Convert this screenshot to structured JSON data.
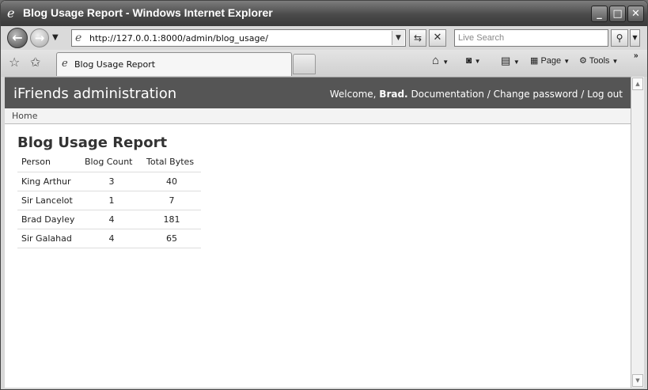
{
  "window": {
    "title": "Blog Usage Report - Windows Internet Explorer",
    "controls": {
      "minimize": "_",
      "maximize": "□",
      "close": "✕"
    }
  },
  "browser": {
    "address": "http://127.0.0.1:8000/admin/blog_usage/",
    "search_placeholder": "Live Search",
    "tab_title": "Blog Usage Report",
    "toolbar": {
      "page_label": "Page",
      "tools_label": "Tools",
      "more": "»"
    },
    "icons": {
      "back": "back-arrow-icon",
      "forward": "forward-arrow-icon",
      "refresh": "refresh-icon",
      "stop": "stop-icon",
      "search": "magnifier-icon",
      "favorites": "star-icon",
      "add_favorite": "star-plus-icon",
      "home": "home-icon",
      "feeds": "rss-icon",
      "print": "printer-icon",
      "page": "page-icon",
      "tools": "gear-icon"
    }
  },
  "admin": {
    "site_name": "iFriends administration",
    "welcome": "Welcome,",
    "user_name": "Brad.",
    "links": {
      "documentation": "Documentation",
      "change_password": "Change password",
      "logout": "Log out"
    },
    "separator": "/",
    "breadcrumb": "Home"
  },
  "report": {
    "title": "Blog Usage Report",
    "columns": [
      "Person",
      "Blog Count",
      "Total Bytes"
    ],
    "rows": [
      [
        "King Arthur",
        "3",
        "40"
      ],
      [
        "Sir Lancelot",
        "1",
        "7"
      ],
      [
        "Brad Dayley",
        "4",
        "181"
      ],
      [
        "Sir Galahad",
        "4",
        "65"
      ]
    ]
  }
}
